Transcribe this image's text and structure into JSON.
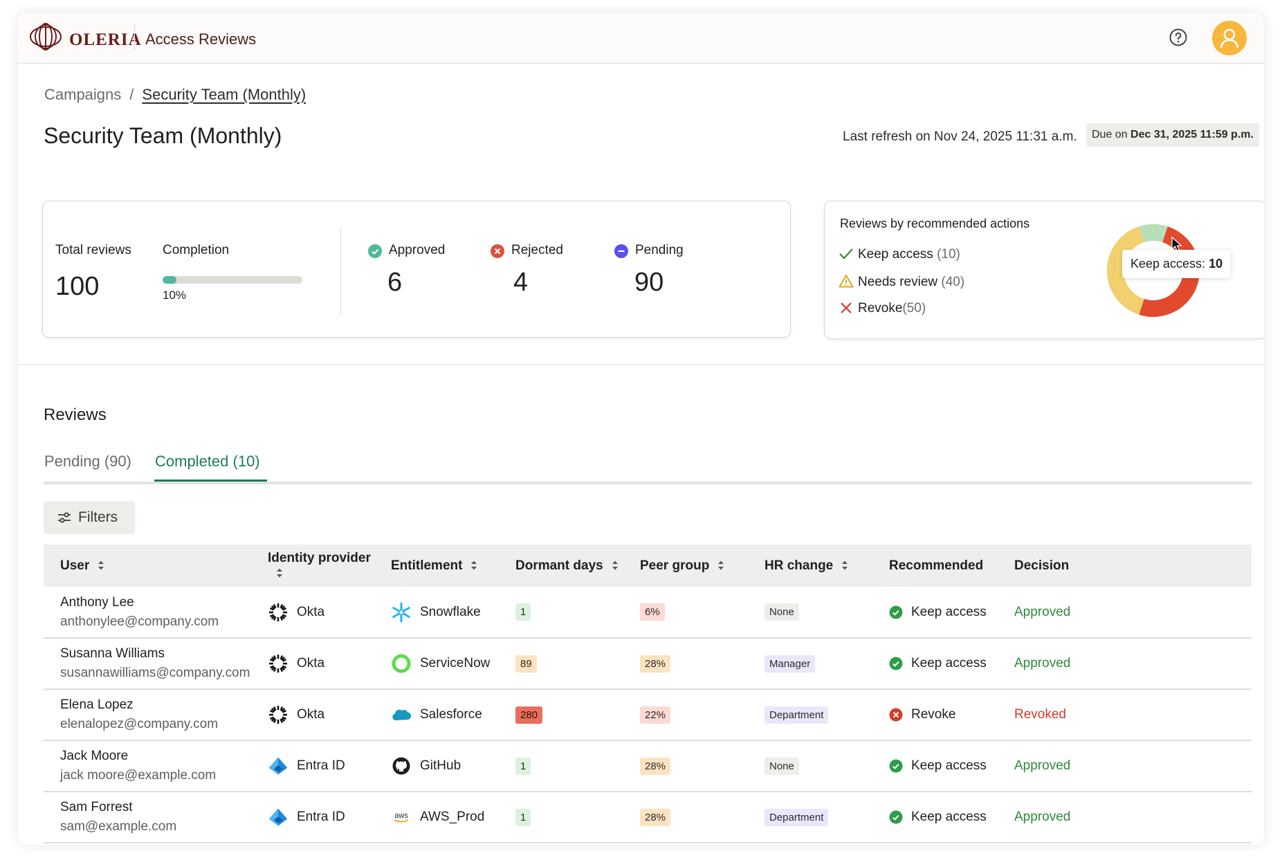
{
  "header": {
    "brand": "OLERIA",
    "app_title": "Access Reviews"
  },
  "breadcrumb": {
    "parent": "Campaigns",
    "separator": "/",
    "current": "Security Team (Monthly)"
  },
  "page": {
    "title": "Security Team (Monthly)",
    "last_refresh": "Last refresh on Nov 24, 2025 11:31 a.m.",
    "due_prefix": "Due on",
    "due_date": "Dec 31, 2025 11:59 p.m."
  },
  "stats": {
    "total_label": "Total reviews",
    "total_value": "100",
    "completion_label": "Completion",
    "completion_value": "10%",
    "completion_fraction": 0.1,
    "approved_label": "Approved",
    "approved_value": "6",
    "rejected_label": "Rejected",
    "rejected_value": "4",
    "pending_label": "Pending",
    "pending_value": "90"
  },
  "recommended": {
    "title": "Reviews by recommended actions",
    "items": [
      {
        "label": "Keep access",
        "count": "(10)",
        "value": 10,
        "color": "#b6dfb9"
      },
      {
        "label": "Needs review",
        "count": "(40)",
        "value": 40,
        "color": "#f3d06e"
      },
      {
        "label": "Revoke",
        "count": "(50)",
        "value": 50,
        "color": "#e24a2e"
      }
    ],
    "tooltip_label": "Keep access:",
    "tooltip_value": "10"
  },
  "reviews": {
    "title": "Reviews",
    "tabs": [
      {
        "label": "Pending (90)",
        "active": false
      },
      {
        "label": "Completed (10)",
        "active": true
      }
    ],
    "filters_label": "Filters",
    "columns": [
      "User",
      "Identity provider",
      "Entitlement",
      "Dormant days",
      "Peer group",
      "HR change",
      "Recommended",
      "Decision"
    ],
    "rows": [
      {
        "name": "Anthony Lee",
        "email": "anthonylee@company.com",
        "idp": "Okta",
        "entitlement": "Snowflake",
        "dormant": "1",
        "peer": "6%",
        "hr": "None",
        "recommended": "Keep access",
        "decision": "Approved"
      },
      {
        "name": "Susanna Williams",
        "email": "susannawilliams@company.com",
        "idp": "Okta",
        "entitlement": "ServiceNow",
        "dormant": "89",
        "peer": "28%",
        "hr": "Manager",
        "recommended": "Keep access",
        "decision": "Approved"
      },
      {
        "name": "Elena Lopez",
        "email": "elenalopez@company.com",
        "idp": "Okta",
        "entitlement": "Salesforce",
        "dormant": "280",
        "peer": "22%",
        "hr": "Department",
        "recommended": "Revoke",
        "decision": "Revoked"
      },
      {
        "name": "Jack Moore",
        "email": "jack moore@example.com",
        "idp": "Entra ID",
        "entitlement": "GitHub",
        "dormant": "1",
        "peer": "28%",
        "hr": "None",
        "recommended": "Keep access",
        "decision": "Approved"
      },
      {
        "name": "Sam Forrest",
        "email": "sam@example.com",
        "idp": "Entra ID",
        "entitlement": "AWS_Prod",
        "dormant": "1",
        "peer": "28%",
        "hr": "Department",
        "recommended": "Keep access",
        "decision": "Approved"
      }
    ]
  },
  "icons": {
    "help": "help-circle-icon",
    "avatar": "user-icon",
    "okta": "okta-logo-icon",
    "entra": "entra-id-logo-icon",
    "snowflake": "snowflake-logo-icon",
    "servicenow": "servicenow-logo-icon",
    "salesforce": "salesforce-logo-icon",
    "github": "github-logo-icon",
    "aws": "aws-logo-icon"
  }
}
